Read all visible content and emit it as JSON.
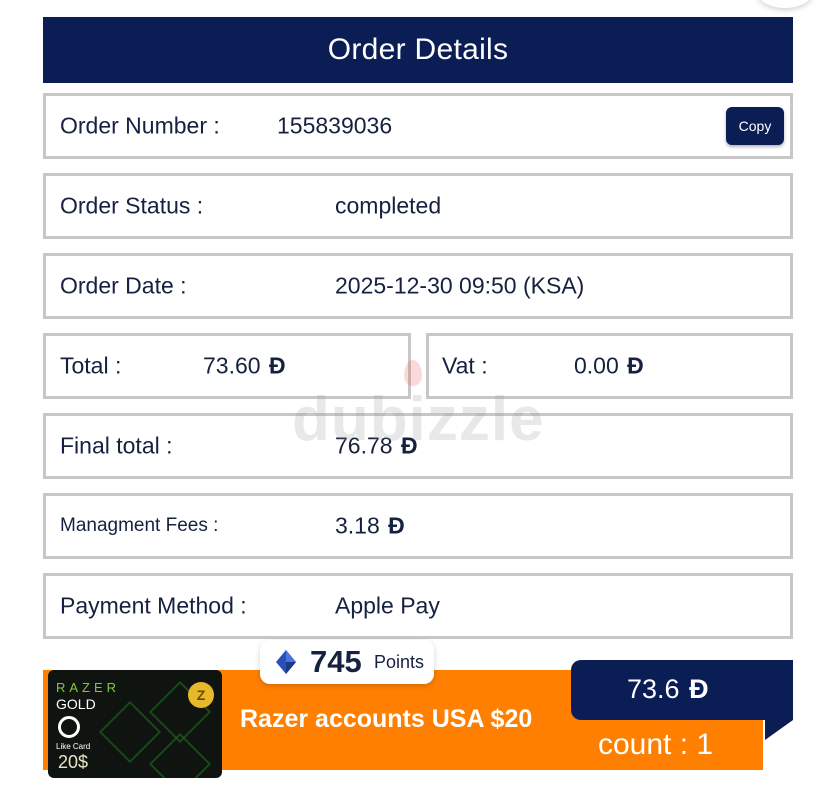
{
  "header": {
    "title": "Order Details"
  },
  "order": {
    "number_label": "Order Number :",
    "number_value": "155839036",
    "copy_label": "Copy",
    "status_label": "Order Status :",
    "status_value": "completed",
    "date_label": "Order Date :",
    "date_value": "2025-12-30 09:50 (KSA)",
    "total_label": "Total :",
    "total_value": "73.60",
    "vat_label": "Vat :",
    "vat_value": "0.00",
    "final_label": "Final total :",
    "final_value": "76.78",
    "fees_label": "Managment Fees :",
    "fees_value": "3.18",
    "payment_label": "Payment Method :",
    "payment_value": "Apple Pay",
    "currency_symbol": "Đ"
  },
  "watermark": "dubizzle",
  "product": {
    "name": "Razer accounts USA $20",
    "points_value": "745",
    "points_label": "Points",
    "price_value": "73.6",
    "count_text": "count :  1",
    "thumb": {
      "brand": "RAZER",
      "line": "GOLD",
      "vendor": "Like Card",
      "amount": "20$",
      "coin": "Z"
    }
  },
  "colors": {
    "navy": "#0b1d55",
    "orange": "#ff8000",
    "border_gray": "#c7c7c7",
    "text": "#16213f"
  }
}
